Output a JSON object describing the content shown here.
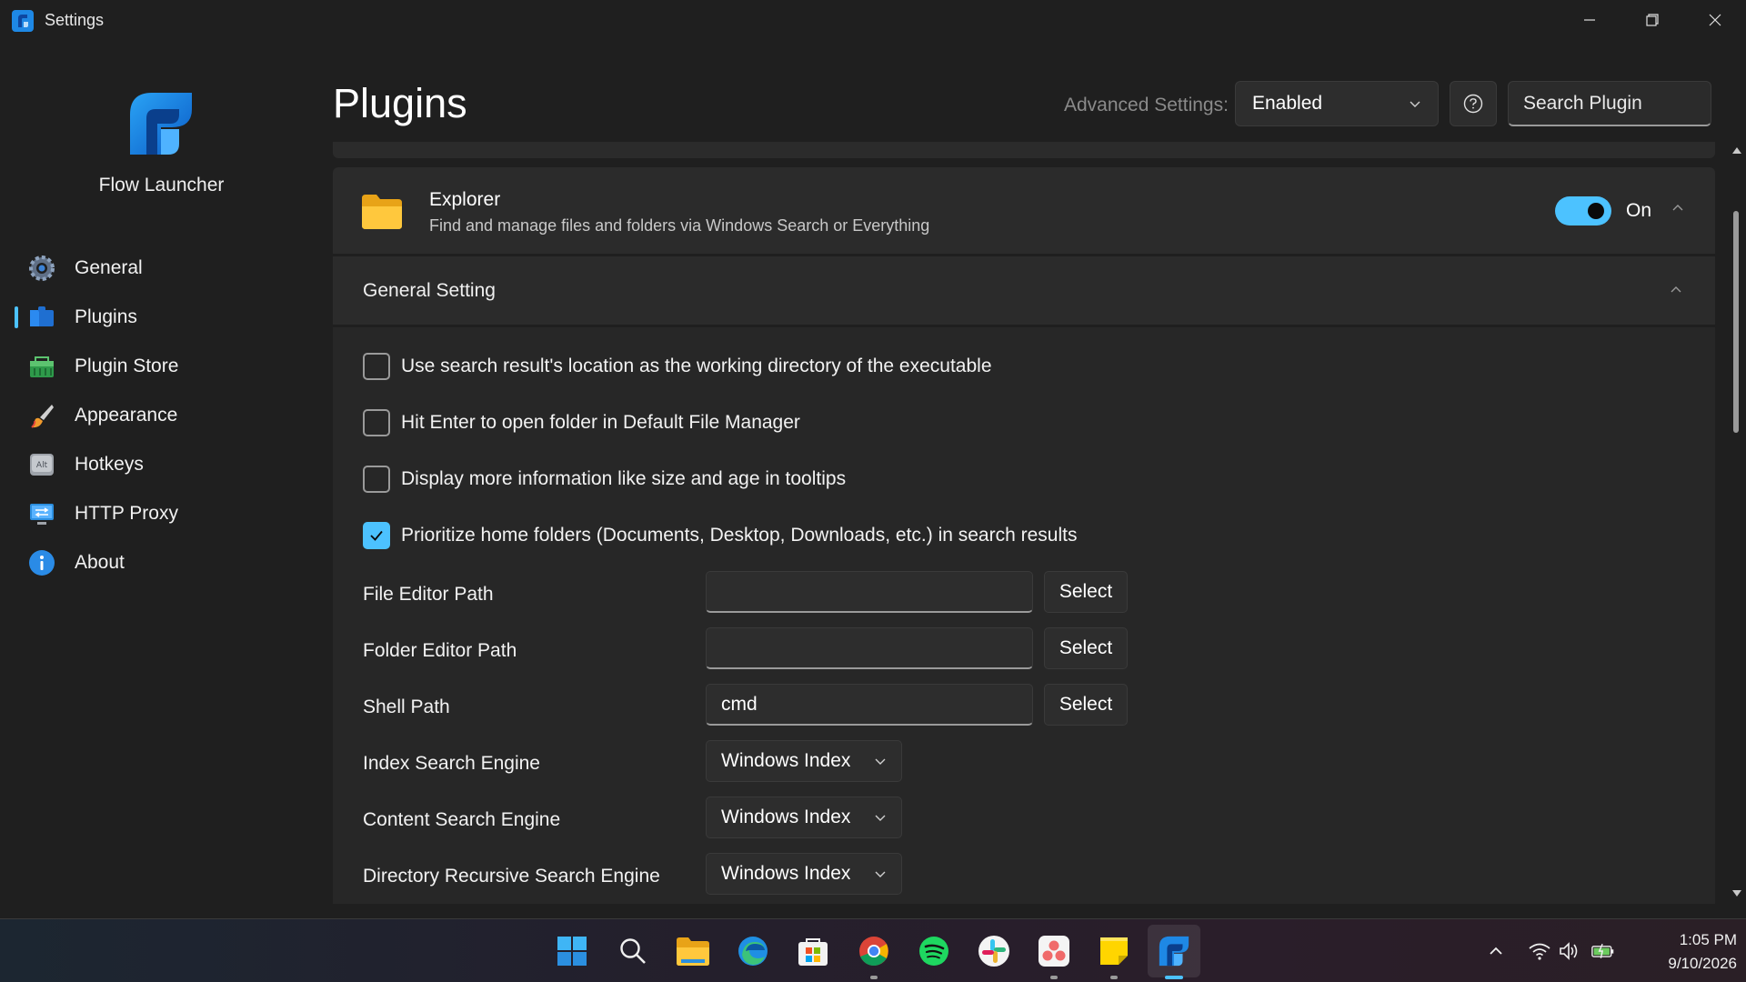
{
  "window": {
    "title": "Settings"
  },
  "sidebar": {
    "brand_name": "Flow Launcher",
    "items": [
      {
        "label": "General",
        "icon": "gear-icon"
      },
      {
        "label": "Plugins",
        "icon": "plugin-icon",
        "active": true
      },
      {
        "label": "Plugin Store",
        "icon": "store-icon"
      },
      {
        "label": "Appearance",
        "icon": "paintbrush-icon"
      },
      {
        "label": "Hotkeys",
        "icon": "keyboard-icon"
      },
      {
        "label": "HTTP Proxy",
        "icon": "network-icon"
      },
      {
        "label": "About",
        "icon": "info-icon"
      }
    ]
  },
  "header": {
    "title": "Plugins",
    "advanced_label": "Advanced Settings:",
    "advanced_value": "Enabled",
    "search_placeholder": "Search Plugin"
  },
  "plugin": {
    "name": "Explorer",
    "description": "Find and manage files and folders via Windows Search or Everything",
    "enabled": true,
    "toggle_label": "On"
  },
  "section": {
    "title": "General Setting",
    "checkboxes": [
      {
        "label": "Use search result's location as the working directory of the executable",
        "checked": false
      },
      {
        "label": "Hit Enter to open folder in Default File Manager",
        "checked": false
      },
      {
        "label": "Display more information like size and age in tooltips",
        "checked": false
      },
      {
        "label": "Prioritize home folders (Documents, Desktop, Downloads, etc.) in search results",
        "checked": true
      }
    ],
    "paths": [
      {
        "label": "File Editor Path",
        "value": "",
        "button": "Select"
      },
      {
        "label": "Folder Editor Path",
        "value": "",
        "button": "Select"
      },
      {
        "label": "Shell Path",
        "value": "cmd",
        "button": "Select"
      }
    ],
    "engines": [
      {
        "label": "Index Search Engine",
        "value": "Windows Index"
      },
      {
        "label": "Content Search Engine",
        "value": "Windows Index"
      },
      {
        "label": "Directory Recursive Search Engine",
        "value": "Windows Index"
      }
    ]
  },
  "taskbar": {
    "time": "1:05 PM",
    "date": "9/10/2026"
  },
  "colors": {
    "accent": "#4cc2ff",
    "background": "#1f1f1f",
    "card": "#2b2b2b"
  }
}
